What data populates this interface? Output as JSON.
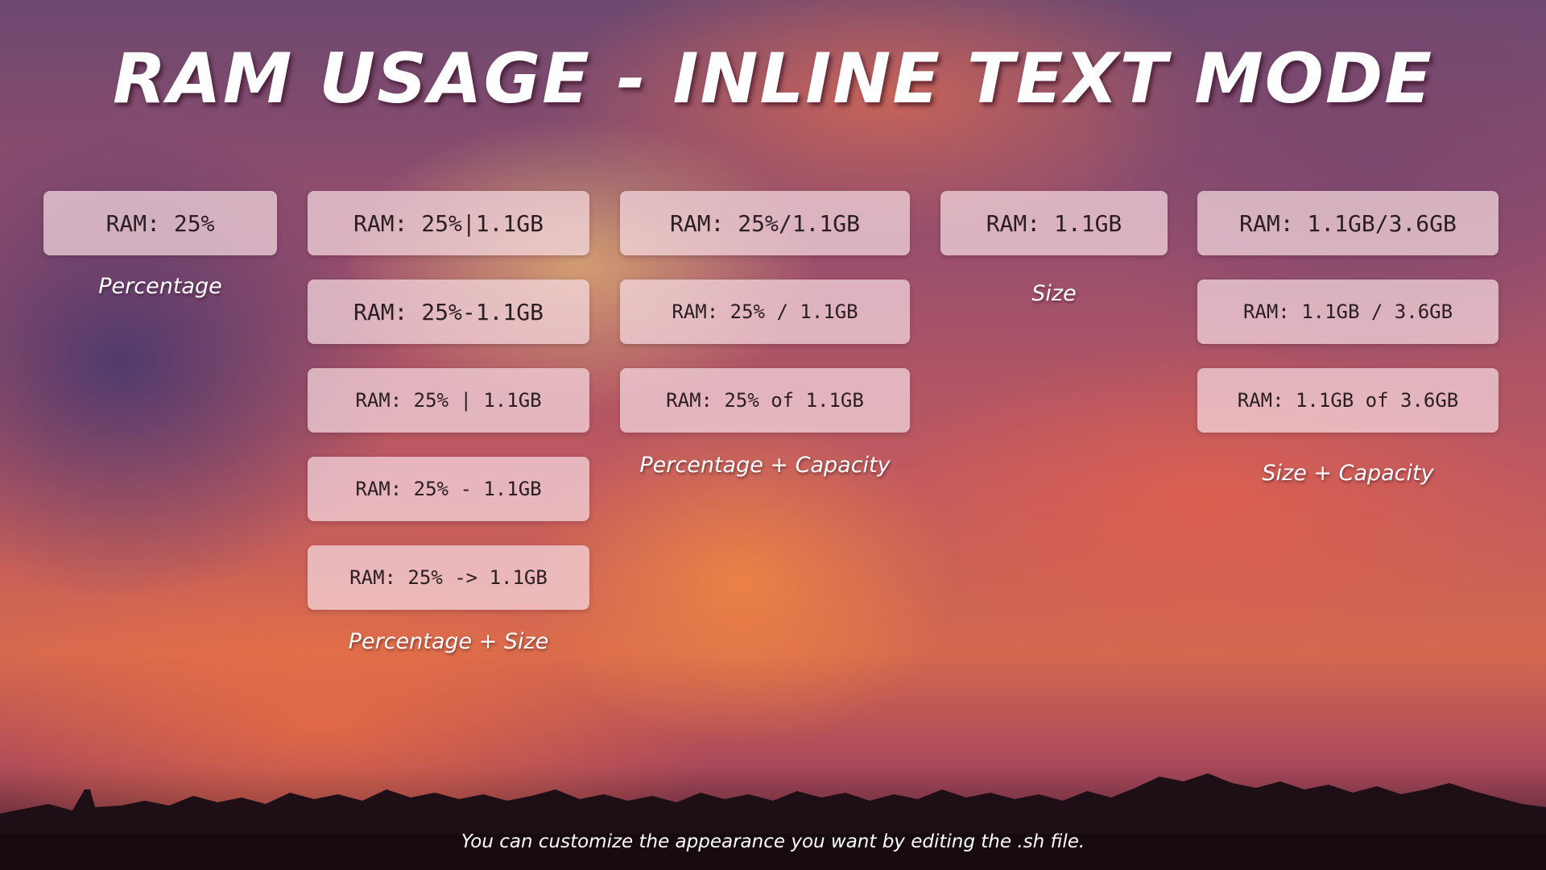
{
  "title": "RAM USAGE - INLINE TEXT MODE",
  "groups": {
    "percentage": {
      "items": [
        "RAM: 25%"
      ],
      "label": "Percentage"
    },
    "percentage_size": {
      "items": [
        "RAM: 25%|1.1GB",
        "RAM: 25%-1.1GB",
        "RAM: 25% | 1.1GB",
        "RAM: 25% - 1.1GB",
        "RAM: 25% -> 1.1GB"
      ],
      "label": "Percentage + Size"
    },
    "percentage_capacity": {
      "items": [
        "RAM: 25%/1.1GB",
        "RAM: 25% / 1.1GB",
        "RAM: 25% of 1.1GB"
      ],
      "label": "Percentage + Capacity"
    },
    "size": {
      "items": [
        "RAM: 1.1GB"
      ],
      "label": "Size"
    },
    "size_capacity": {
      "items": [
        "RAM: 1.1GB/3.6GB",
        "RAM: 1.1GB / 3.6GB",
        "RAM: 1.1GB of 3.6GB"
      ],
      "label": "Size + Capacity"
    }
  },
  "footer": "You can customize the appearance you want by editing the .sh file."
}
